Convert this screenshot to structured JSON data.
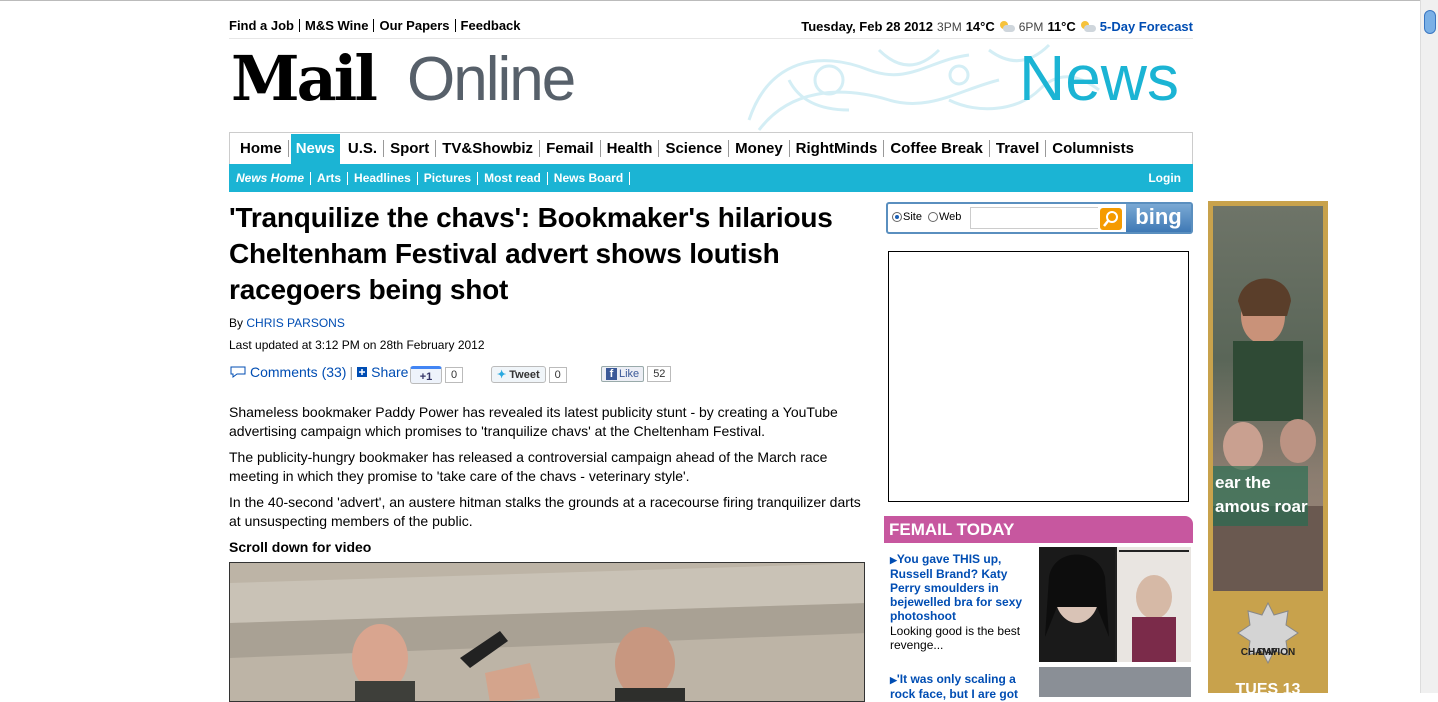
{
  "topbar": {
    "links": [
      "Find a Job",
      "M&S Wine",
      "Our Papers",
      "Feedback"
    ],
    "date": "Tuesday, Feb 28 2012",
    "time1": "3PM",
    "temp1": "14°C",
    "time2": "6PM",
    "temp2": "11°C",
    "forecast_link": "5-Day Forecast"
  },
  "masthead": {
    "logo_bold": "Mail",
    "logo_light": "Online",
    "section": "News"
  },
  "nav": {
    "items": [
      "Home",
      "News",
      "U.S.",
      "Sport",
      "TV&Showbiz",
      "Femail",
      "Health",
      "Science",
      "Money",
      "RightMinds",
      "Coffee Break",
      "Travel",
      "Columnists"
    ],
    "active": "News"
  },
  "subnav": {
    "items": [
      "News Home",
      "Arts",
      "Headlines",
      "Pictures",
      "Most read",
      "News Board"
    ],
    "login": "Login"
  },
  "article": {
    "headline": "'Tranquilize the chavs': Bookmaker's hilarious Cheltenham Festival advert shows loutish racegoers being shot",
    "by": "By",
    "author": "CHRIS PARSONS",
    "updated": "Last updated at 3:12 PM on 28th February 2012",
    "comments": "Comments (33)",
    "share": "Share",
    "gplus_label": "+1",
    "gplus_count": "0",
    "tweet_label": "Tweet",
    "tweet_count": "0",
    "like_label": "Like",
    "like_count": "52",
    "paragraphs": [
      "Shameless bookmaker Paddy Power has revealed its latest publicity stunt - by creating a YouTube advertising campaign which promises to 'tranquilize chavs' at the Cheltenham Festival.",
      "The publicity-hungry bookmaker has released a controversial campaign ahead of the March race meeting in which they promise to 'take care of the chavs - veterinary style'.",
      "In the 40-second 'advert', an austere hitman stalks the grounds at a racecourse firing tranquilizer darts at unsuspecting members of the public."
    ],
    "scroll_note": "Scroll down for video"
  },
  "search": {
    "option_site": "Site",
    "option_web": "Web",
    "placeholder": "",
    "brand": "bing"
  },
  "femail": {
    "header": "FEMAIL TODAY",
    "story1_title": "You gave THIS up, Russell Brand? Katy Perry smoulders in bejewelled bra for sexy photoshoot",
    "story1_sub": "Looking good is the best revenge...",
    "story2_title": "'It was only scaling a rock face, but I are got"
  },
  "sky_ad": {
    "roar_line1": "ear the",
    "roar_line2": "amous roar",
    "badge_line1": "CHAMPION",
    "badge_line2": "DAY",
    "date": "TUES 13"
  },
  "colors": {
    "accent": "#1bb4d4",
    "femail": "#c7579f",
    "link": "#004db3",
    "ad_gold": "#c8a24c"
  }
}
